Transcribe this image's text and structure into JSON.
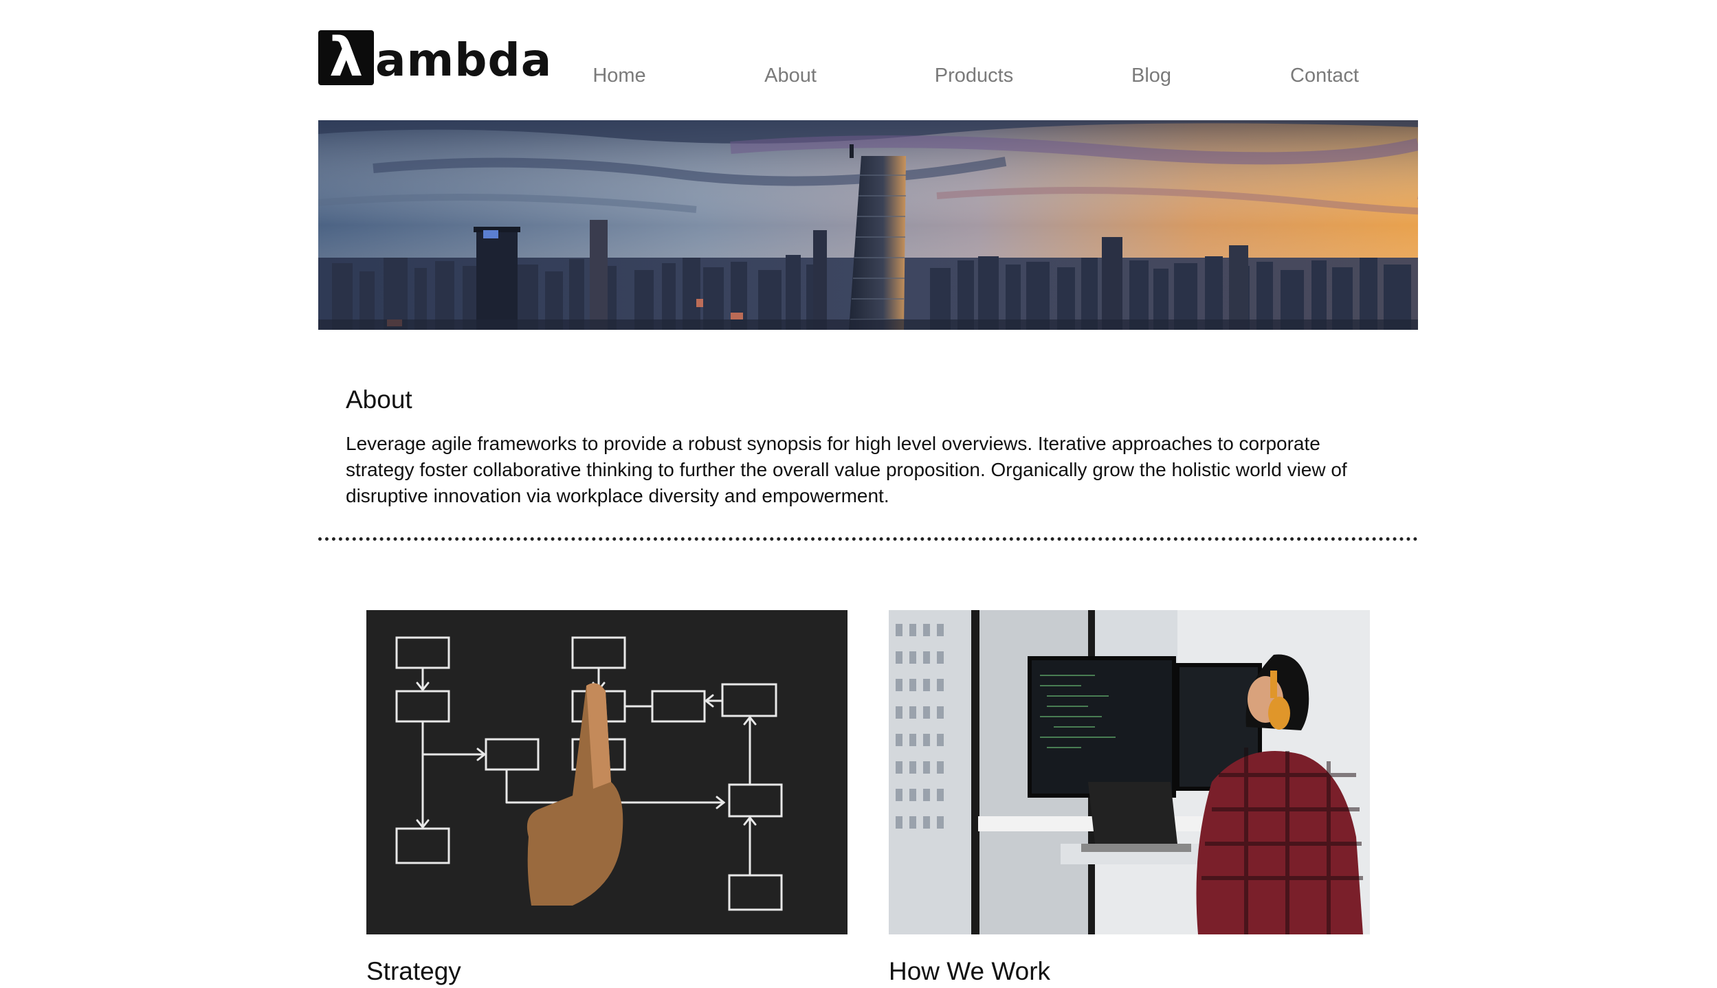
{
  "header": {
    "logo_symbol": "λ",
    "logo_text": "ambda"
  },
  "nav": {
    "items": [
      {
        "label": "Home"
      },
      {
        "label": "About"
      },
      {
        "label": "Products"
      },
      {
        "label": "Blog"
      },
      {
        "label": "Contact"
      }
    ]
  },
  "hero": {
    "image": "city-skyline-sunset"
  },
  "about": {
    "title": "About",
    "body": "Leverage agile frameworks to provide a robust synopsis for high level overviews. Iterative approaches to corporate strategy foster collaborative thinking to further the overall value proposition. Organically grow the holistic world view of disruptive innovation via workplace diversity and empowerment."
  },
  "cards": [
    {
      "title": "Strategy",
      "image": "flowchart-chalkboard"
    },
    {
      "title": "How We Work",
      "image": "developer-at-monitors"
    }
  ]
}
